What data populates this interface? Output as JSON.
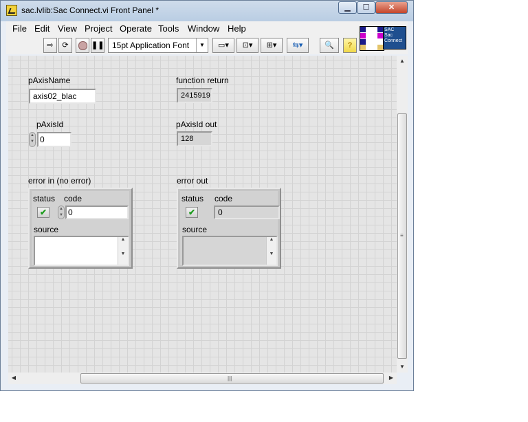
{
  "window": {
    "title": "sac.lvlib:Sac Connect.vi Front Panel *",
    "minimize_label": "▁",
    "maximize_label": "☐",
    "close_label": "✕"
  },
  "menu": [
    "File",
    "Edit",
    "View",
    "Project",
    "Operate",
    "Tools",
    "Window",
    "Help"
  ],
  "toolbar": {
    "font_selector": "15pt Application Font",
    "icons": [
      "run-arrow-icon",
      "run-continuously-icon",
      "abort-icon",
      "pause-icon",
      "align-objects-icon",
      "distribute-objects-icon",
      "resize-objects-icon",
      "reorder-icon",
      "search-icon",
      "context-help-icon"
    ]
  },
  "vi_icon": {
    "label_lines": [
      "SAC",
      "Sac",
      "Connect"
    ]
  },
  "controls": {
    "pAxisName": {
      "label": "pAxisName",
      "value": "axis02_blac"
    },
    "function_return": {
      "label": "function return",
      "value": "2415919"
    },
    "pAxisId": {
      "label": "pAxisId",
      "value": "0"
    },
    "pAxisId_out": {
      "label": "pAxisId out",
      "value": "128"
    },
    "error_in": {
      "label": "error in (no error)",
      "status_label": "status",
      "code_label": "code",
      "code_value": "0",
      "status_mark": "✔",
      "source_label": "source",
      "source_value": ""
    },
    "error_out": {
      "label": "error out",
      "status_label": "status",
      "code_label": "code",
      "code_value": "0",
      "status_mark": "✔",
      "source_label": "source",
      "source_value": ""
    }
  },
  "colors": {
    "panel_bg": "#e5e5e5",
    "grid": "#d3d3d3",
    "status_ok": "#1c9b1c",
    "titlebar": "#c4d5e9"
  }
}
